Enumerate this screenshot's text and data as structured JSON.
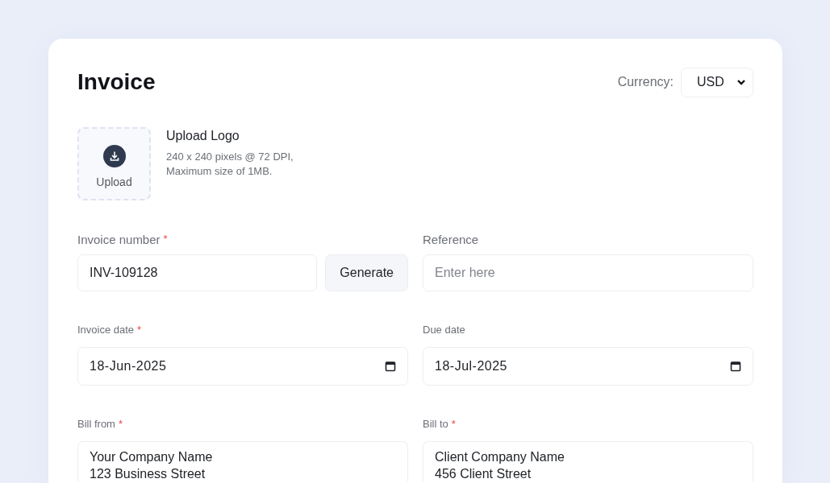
{
  "title": "Invoice",
  "currency": {
    "label": "Currency:",
    "value": "USD"
  },
  "logo_upload": {
    "button": "Upload",
    "title": "Upload Logo",
    "hint_lines": [
      "240 x 240 pixels @ 72 DPI,",
      "Maximum size of 1MB."
    ]
  },
  "rows": [
    {
      "kind": "large",
      "fields": [
        {
          "kind": "text",
          "label": "Invoice number",
          "required_mark": "*",
          "value": "INV-109128",
          "action": "Generate"
        },
        {
          "kind": "text",
          "label": "Reference",
          "placeholder": "Enter here"
        }
      ]
    },
    {
      "kind": "small",
      "fields": [
        {
          "kind": "date",
          "label": "Invoice date",
          "required_mark": "*",
          "value": "18-Jun-2025"
        },
        {
          "kind": "date",
          "label": "Due date",
          "value": "18-Jul-2025"
        }
      ]
    },
    {
      "kind": "small",
      "fields": [
        {
          "kind": "textarea",
          "label": "Bill from",
          "required_mark": "*",
          "lines": [
            "Your Company Name",
            "123 Business Street"
          ]
        },
        {
          "kind": "textarea",
          "label": "Bill to",
          "required_mark": "*",
          "lines": [
            "Client Company Name",
            "456 Client Street"
          ]
        }
      ]
    }
  ]
}
